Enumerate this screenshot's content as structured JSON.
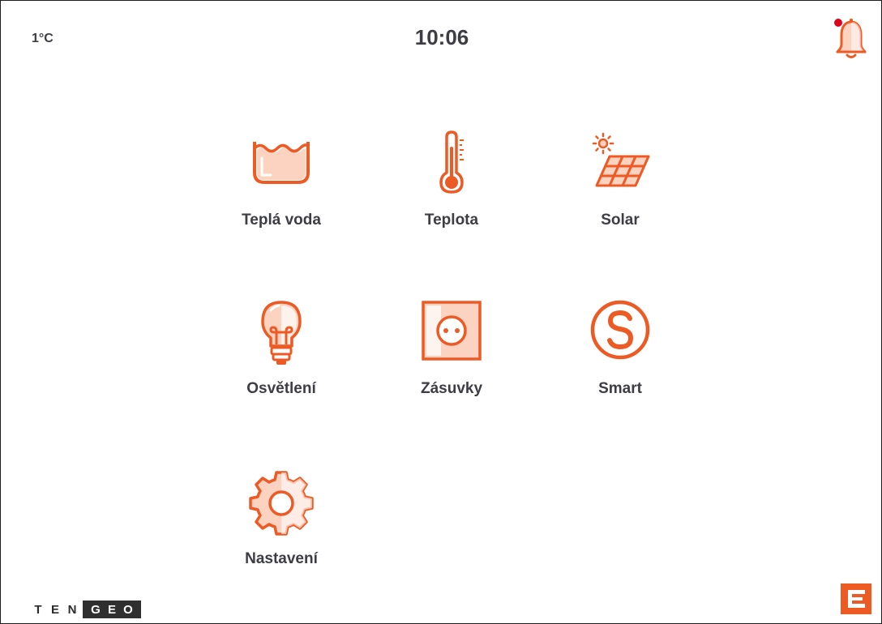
{
  "header": {
    "temperature": "1°C",
    "time": "10:06",
    "notification_icon": "bell-icon",
    "notification_dot_color": "#e0001b"
  },
  "colors": {
    "accent": "#ee5a24",
    "accent_light": "#fbd3c0",
    "text": "#3d3d44"
  },
  "tiles": [
    {
      "label": "Teplá voda",
      "icon": "water-tank-icon"
    },
    {
      "label": "Teplota",
      "icon": "thermometer-icon"
    },
    {
      "label": "Solar",
      "icon": "solar-panel-icon"
    },
    {
      "label": "Osvětlení",
      "icon": "light-bulb-icon"
    },
    {
      "label": "Zásuvky",
      "icon": "power-socket-icon"
    },
    {
      "label": "Smart",
      "icon": "smart-s-icon"
    },
    {
      "label": "Nastavení",
      "icon": "gear-icon"
    }
  ],
  "footer": {
    "brand_plain": [
      "T",
      "E",
      "N"
    ],
    "brand_dark": [
      "G",
      "E",
      "O"
    ],
    "corner_logo": "cez-logo"
  }
}
